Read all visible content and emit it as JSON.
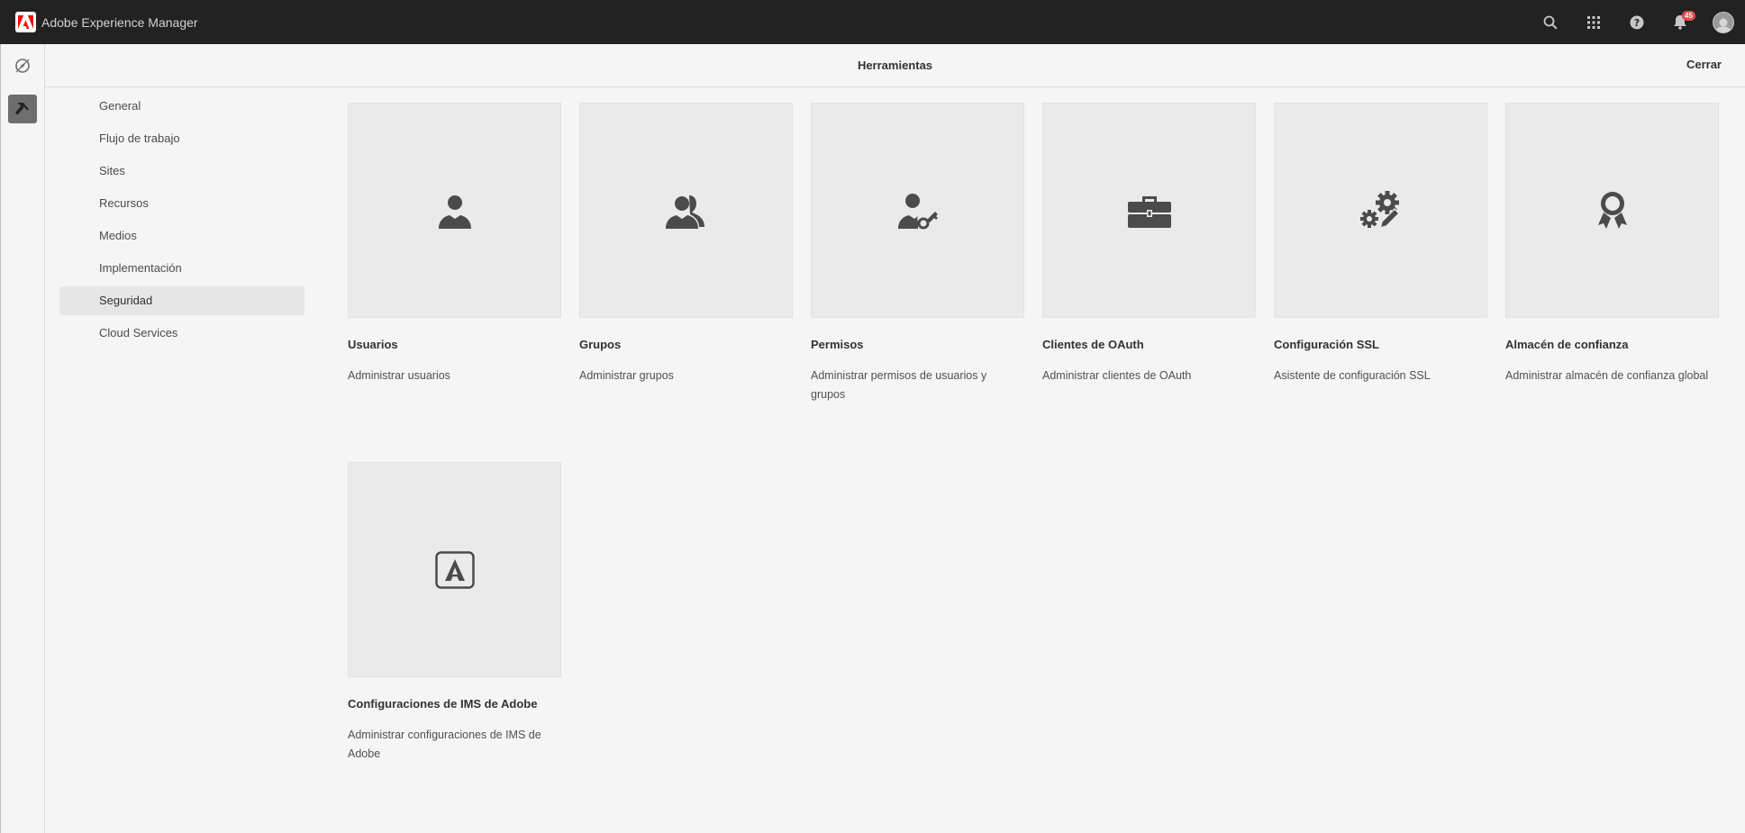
{
  "header": {
    "brand_title": "Adobe Experience Manager",
    "notification_count": "45",
    "icons": [
      "adobe-logo-icon",
      "search-icon",
      "apps-grid-icon",
      "help-icon",
      "bell-icon",
      "avatar"
    ]
  },
  "rail": {
    "icons": [
      "navigation-compass-icon",
      "hammer-tools-icon"
    ]
  },
  "actionbar": {
    "title": "Herramientas",
    "close_label": "Cerrar"
  },
  "nav": {
    "items": [
      {
        "label": "General"
      },
      {
        "label": "Flujo de trabajo"
      },
      {
        "label": "Sites"
      },
      {
        "label": "Recursos"
      },
      {
        "label": "Medios"
      },
      {
        "label": "Implementación"
      },
      {
        "label": "Seguridad",
        "selected": true
      },
      {
        "label": "Cloud Services"
      }
    ]
  },
  "cards": [
    {
      "title": "Usuarios",
      "desc": "Administrar usuarios",
      "icon": "user-icon"
    },
    {
      "title": "Grupos",
      "desc": "Administrar grupos",
      "icon": "user-group-icon"
    },
    {
      "title": "Permisos",
      "desc": "Administrar permisos de usuarios y grupos",
      "icon": "user-key-icon"
    },
    {
      "title": "Clientes de OAuth",
      "desc": "Administrar clientes de OAuth",
      "icon": "toolbox-icon"
    },
    {
      "title": "Configuración SSL",
      "desc": "Asistente de configuración SSL",
      "icon": "gears-edit-icon"
    },
    {
      "title": "Almacén de confianza",
      "desc": "Administrar almacén de confianza global",
      "icon": "award-ribbon-icon"
    },
    {
      "title": "Configuraciones de IMS de Adobe",
      "desc": "Administrar configuraciones de IMS de Adobe",
      "icon": "adobe-logo-icon"
    }
  ],
  "colors": {
    "topbar": "#222222",
    "background": "#f5f5f5",
    "card_thumb": "#eaeaea",
    "badge": "#e34850",
    "adobe_red": "#eb1000",
    "icon": "#4b4b4b"
  }
}
